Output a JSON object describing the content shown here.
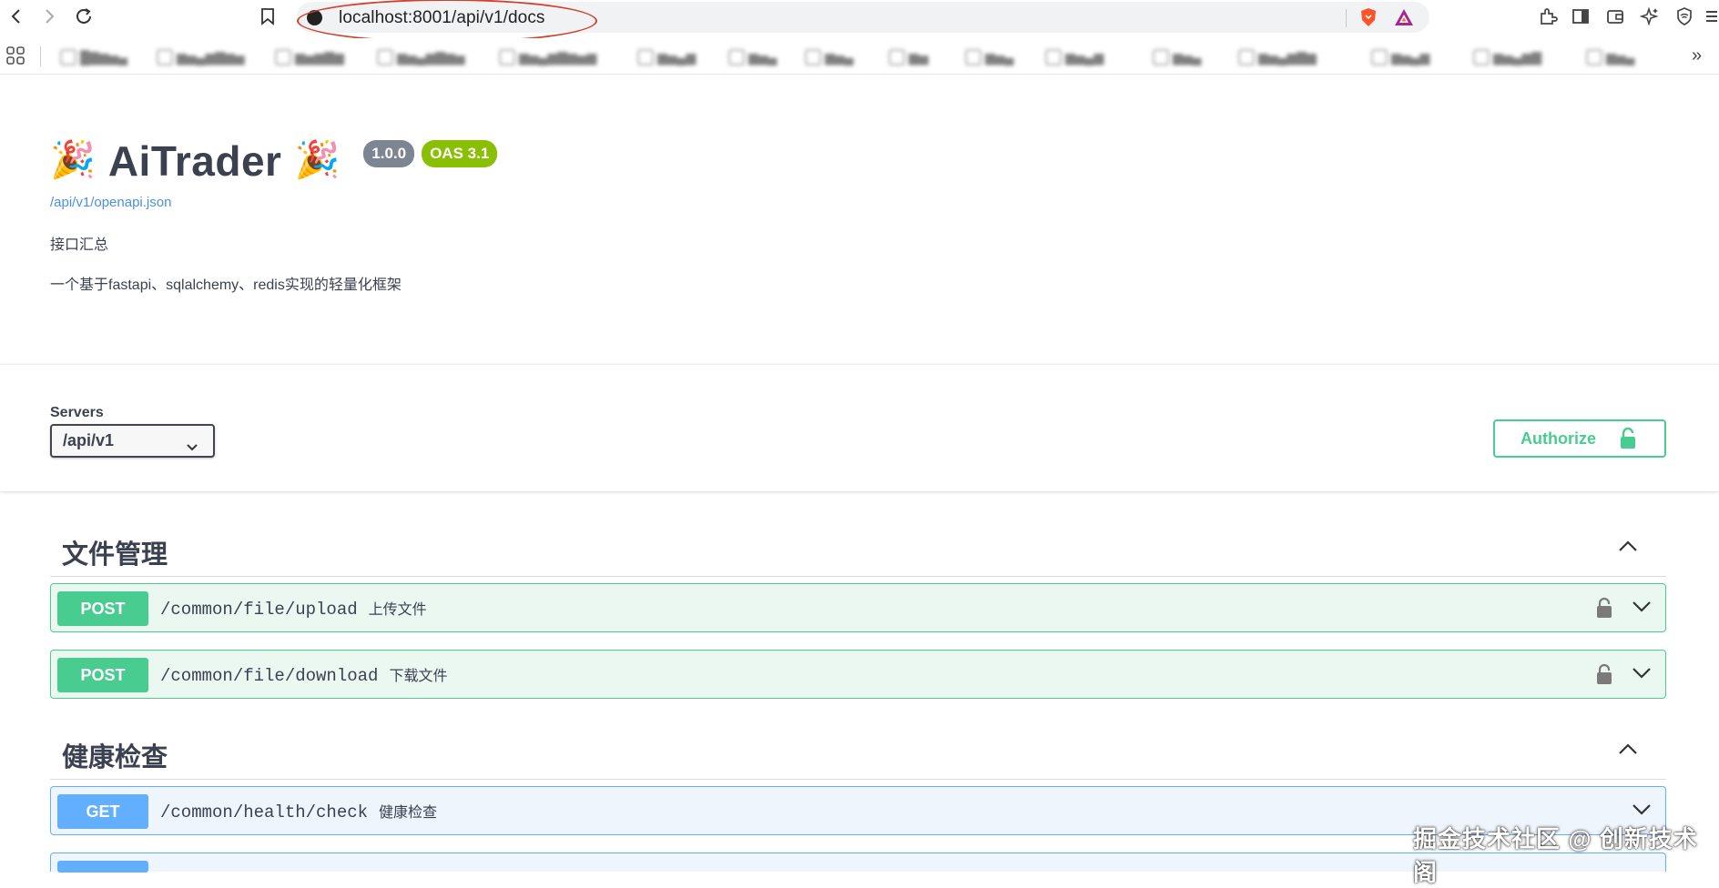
{
  "browser": {
    "url": "localhost:8001/api/v1/docs",
    "bookmarks_overflow": "»"
  },
  "info": {
    "title": "AiTrader",
    "party_emoji": "🎉",
    "version": "1.0.0",
    "oas": "OAS 3.1",
    "spec_link": "/api/v1/openapi.json",
    "desc_line1": "接口汇总",
    "desc_line2": "一个基于fastapi、sqlalchemy、redis实现的轻量化框架"
  },
  "servers": {
    "label": "Servers",
    "selected": "/api/v1"
  },
  "authorize_label": "Authorize",
  "tags": [
    {
      "name": "文件管理",
      "operations": [
        {
          "method": "POST",
          "path": "/common/file/upload",
          "summary": "上传文件"
        },
        {
          "method": "POST",
          "path": "/common/file/download",
          "summary": "下载文件"
        }
      ]
    },
    {
      "name": "健康检查",
      "operations": [
        {
          "method": "GET",
          "path": "/common/health/check",
          "summary": "健康检查"
        }
      ]
    }
  ],
  "watermark": "掘金技术社区 @ 创新技术阁",
  "colors": {
    "post": "#49cc90",
    "get": "#61affe",
    "badge_version": "#7d8492",
    "badge_oas": "#89bf04",
    "link": "#4990e2"
  }
}
